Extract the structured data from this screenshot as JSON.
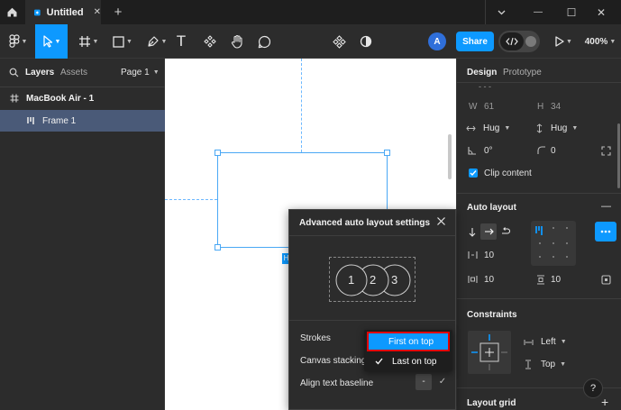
{
  "titlebar": {
    "tab_title": "Untitled",
    "close_glyph": "✕",
    "add_glyph": "+",
    "minimize_glyph": "—",
    "maximize_glyph": "☐",
    "close_window_glyph": "✕"
  },
  "toolbar": {
    "avatar_initial": "A",
    "share_label": "Share",
    "zoom_label": "400%",
    "text_tool_glyph": "T"
  },
  "layers_panel": {
    "tab_layers": "Layers",
    "tab_assets": "Assets",
    "page_label": "Page 1",
    "layers": [
      {
        "name": "MacBook Air - 1",
        "level": 0,
        "selected": false
      },
      {
        "name": "Frame 1",
        "level": 1,
        "selected": true
      }
    ]
  },
  "canvas": {
    "selection_tag": "H"
  },
  "design_panel": {
    "tab_design": "Design",
    "tab_prototype": "Prototype",
    "partial_row": "- - -",
    "w_label": "W",
    "w_value": "61",
    "h_label": "H",
    "h_value": "34",
    "hug_width": "Hug",
    "hug_height": "Hug",
    "rotation_value": "0°",
    "radius_value": "0",
    "clip_content_label": "Clip content",
    "clip_content_checked": true,
    "auto_layout_title": "Auto layout",
    "auto_layout_remove": "—",
    "gap_value": "10",
    "padding_h_value": "10",
    "padding_v_value": "10",
    "constraints_title": "Constraints",
    "constraint_h": "Left",
    "constraint_v": "Top",
    "layout_grid_title": "Layout grid",
    "layout_grid_add": "+"
  },
  "modal": {
    "title": "Advanced auto layout settings",
    "preview_circles": [
      "1",
      "2",
      "3"
    ],
    "strokes_label": "Strokes",
    "canvas_stacking_label": "Canvas stacking",
    "align_baseline_label": "Align text baseline",
    "align_baseline_dash": "-",
    "align_baseline_check": "✓"
  },
  "dropdown": {
    "options": [
      {
        "label": "First on top",
        "checked": false,
        "highlighted": true
      },
      {
        "label": "Last on top",
        "checked": true,
        "highlighted": false
      }
    ]
  },
  "help": {
    "label": "?"
  },
  "colors": {
    "accent": "#0d99ff",
    "selection_outline": "#e00000",
    "panel": "#2c2c2c",
    "titlebar": "#1e1e1e"
  }
}
